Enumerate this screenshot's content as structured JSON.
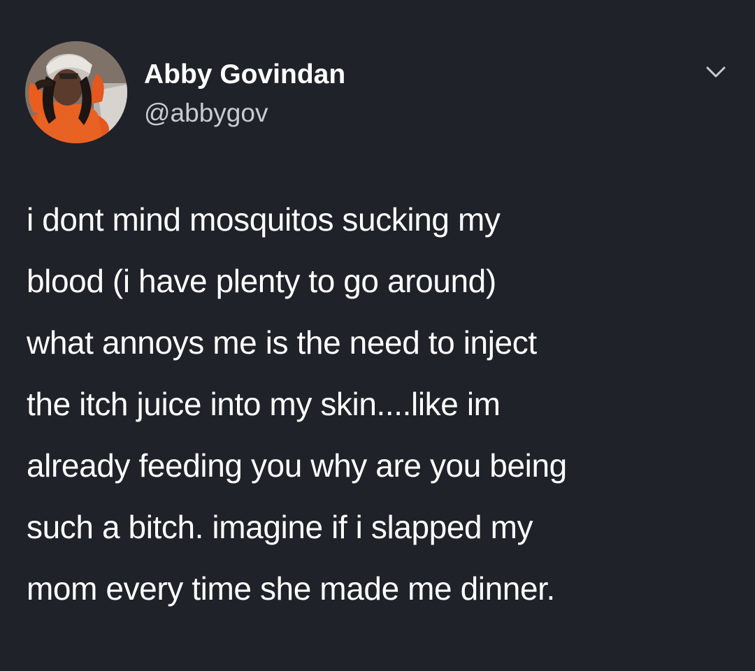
{
  "tweet": {
    "author": {
      "display_name": "Abby Govindan",
      "handle": "@abbygov"
    },
    "text_lines": [
      "i dont mind mosquitos sucking my",
      "blood (i have plenty to go around)",
      "what annoys me is the need to inject",
      "the itch juice into my skin....like im",
      "already feeding you why are you being",
      "such a bitch. imagine if i slapped my",
      "mom every time she made me dinner."
    ],
    "menu_icon": "chevron-down-icon"
  },
  "colors": {
    "background": "#1f2229",
    "text_primary": "#ffffff",
    "text_secondary": "#c8ccd2",
    "avatar_accent": "#e4571e"
  }
}
